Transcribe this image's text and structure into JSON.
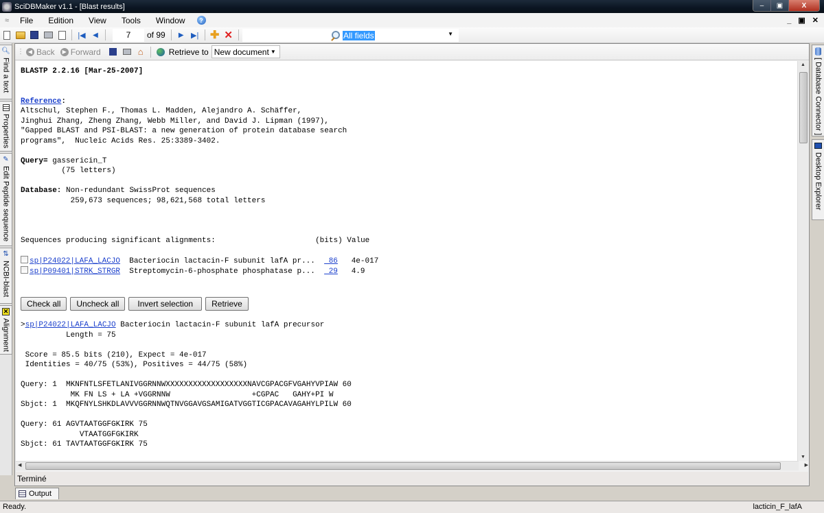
{
  "window": {
    "title": "SciDBMaker v1.1 - [Blast results]",
    "minimize": "–",
    "restore": "▣",
    "close": "X"
  },
  "menu": {
    "items": [
      "File",
      "Edition",
      "View",
      "Tools",
      "Window"
    ],
    "help": "?",
    "mdi": {
      "minimize": "_",
      "restore": "▣",
      "close": "✕"
    }
  },
  "toolbar": {
    "record_number": "7",
    "record_total": "of 99",
    "search_field": "All fields"
  },
  "left_tabs": [
    "Find a text",
    "Properties",
    "Edit Peptide sequence",
    "NCBI-blast",
    "Alignment"
  ],
  "right_tabs": [
    "[ Database Connector ]",
    "Desktop Explorer"
  ],
  "navbar": {
    "back": "Back",
    "forward": "Forward",
    "retrieve_to": "Retrieve to",
    "destination": "New document"
  },
  "blast": {
    "version": "BLASTP 2.2.16 [Mar-25-2007]",
    "reference_label": "Reference",
    "reference_lines": [
      "Altschul, Stephen F., Thomas L. Madden, Alejandro A. Schäffer,",
      "Jinghui Zhang, Zheng Zhang, Webb Miller, and David J. Lipman (1997),",
      "\"Gapped BLAST and PSI-BLAST: a new generation of protein database search",
      "programs\",  Nucleic Acids Res. 25:3389-3402."
    ],
    "query_label": "Query=",
    "query_name": "gassericin_T",
    "query_length": "         (75 letters)",
    "database_label": "Database:",
    "database_name": "Non-redundant SwissProt sequences",
    "database_stats": "           259,673 sequences; 98,621,568 total letters",
    "hits_header": "Sequences producing significant alignments:                      (bits) Value",
    "hits": [
      {
        "id": "sp|P24022|LAFA_LACJO",
        "desc": "  Bacteriocin lactacin-F subunit lafA pr...  ",
        "bits": " 86",
        "evalue": "   4e-017"
      },
      {
        "id": "sp|P09401|STRK_STRGR",
        "desc": "  Streptomycin-6-phosphate phosphatase p...  ",
        "bits": " 29",
        "evalue": "   4.9"
      }
    ],
    "buttons": [
      "Check all",
      "Uncheck all",
      "Invert selection",
      "Retrieve"
    ],
    "alignment": {
      "id": "sp|P24022|LAFA_LACJO",
      "desc": " Bacteriocin lactacin-F subunit lafA precursor",
      "length": "          Length = 75",
      "score": " Score = 85.5 bits (210), Expect = 4e-017",
      "identities": " Identities = 40/75 (53%), Positives = 44/75 (58%)",
      "blocks": [
        [
          "Query: 1  MKNFNTLSFETLANIVGGRNNWXXXXXXXXXXXXXXXXXXNAVCGPACGFVGAHYVPIAW 60",
          "           MK FN LS + LA +VGGRNNW                  +CGPAC   GAHY+PI W",
          "Sbjct: 1  MKQFNYLSHKDLAVVVGGRNNWQTNVGGAVGSAMIGATVGGTICGPACAVAGAHYLPILW 60"
        ],
        [
          "Query: 61 AGVTAATGGFGKIRK 75",
          "             VTAATGGFGKIRK",
          "Sbjct: 61 TAVTAATGGFGKIRK 75"
        ]
      ]
    }
  },
  "doc_status": "Terminé",
  "output_tab": "Output",
  "status": {
    "left": "Ready.",
    "right": "lacticin_F_lafA"
  }
}
